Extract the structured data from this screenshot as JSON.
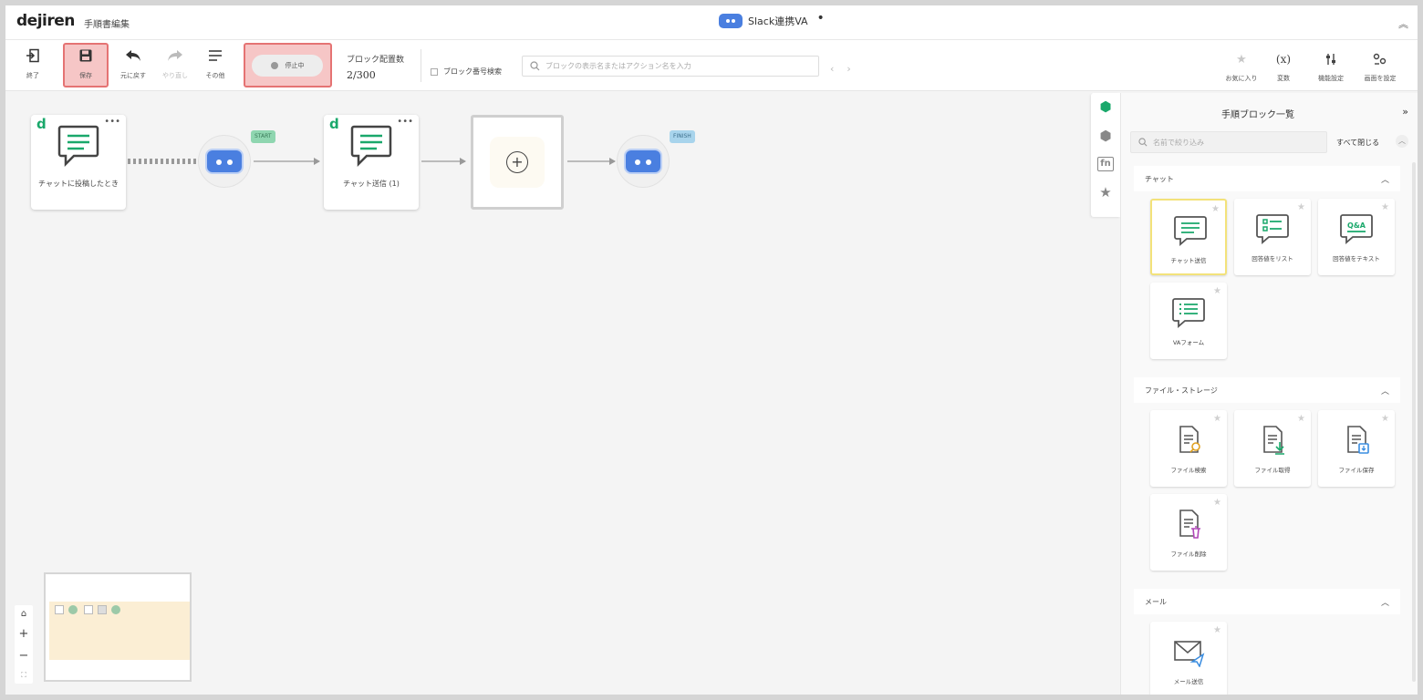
{
  "header": {
    "logo": "dejiren",
    "page_title": "手順書編集",
    "doc_title": "Slack連携VA",
    "dirty_marker": "•",
    "collapse_icon": "chevron-up-double-icon"
  },
  "toolbar": {
    "exit": "終了",
    "save": "保存",
    "undo": "元に戻す",
    "redo": "やり直し",
    "more": "その他",
    "status": "停止中",
    "block_count_label": "ブロック配置数",
    "block_count_value": "2/300",
    "block_number_search_label": "ブロック番号検索",
    "search_placeholder": "ブロックの表示名またはアクション名を入力",
    "favorites": "お気に入り",
    "variables": "変数",
    "feature_settings": "機能設定",
    "screen_settings": "画面を設定"
  },
  "canvas": {
    "nodes": [
      {
        "label": "チャットに投稿したとき"
      },
      {
        "label": "チャット送信 (1)"
      }
    ],
    "start_tag": "START",
    "finish_tag": "FINISH"
  },
  "panel": {
    "title": "手順ブロック一覧",
    "search_placeholder": "名前で絞り込み",
    "close_all": "すべて閉じる",
    "categories": [
      {
        "name": "チャット",
        "items": [
          "チャット送信",
          "回答値をリスト",
          "回答値をテキスト",
          "VAフォーム"
        ]
      },
      {
        "name": "ファイル・ストレージ",
        "items": [
          "ファイル検索",
          "ファイル取得",
          "ファイル保存",
          "ファイル削除"
        ]
      },
      {
        "name": "メール",
        "items": [
          "メール送信"
        ]
      }
    ]
  },
  "colors": {
    "accent_green": "#1aa86b",
    "bot_blue": "#4a7fe0",
    "highlight_red": "#e57373"
  }
}
